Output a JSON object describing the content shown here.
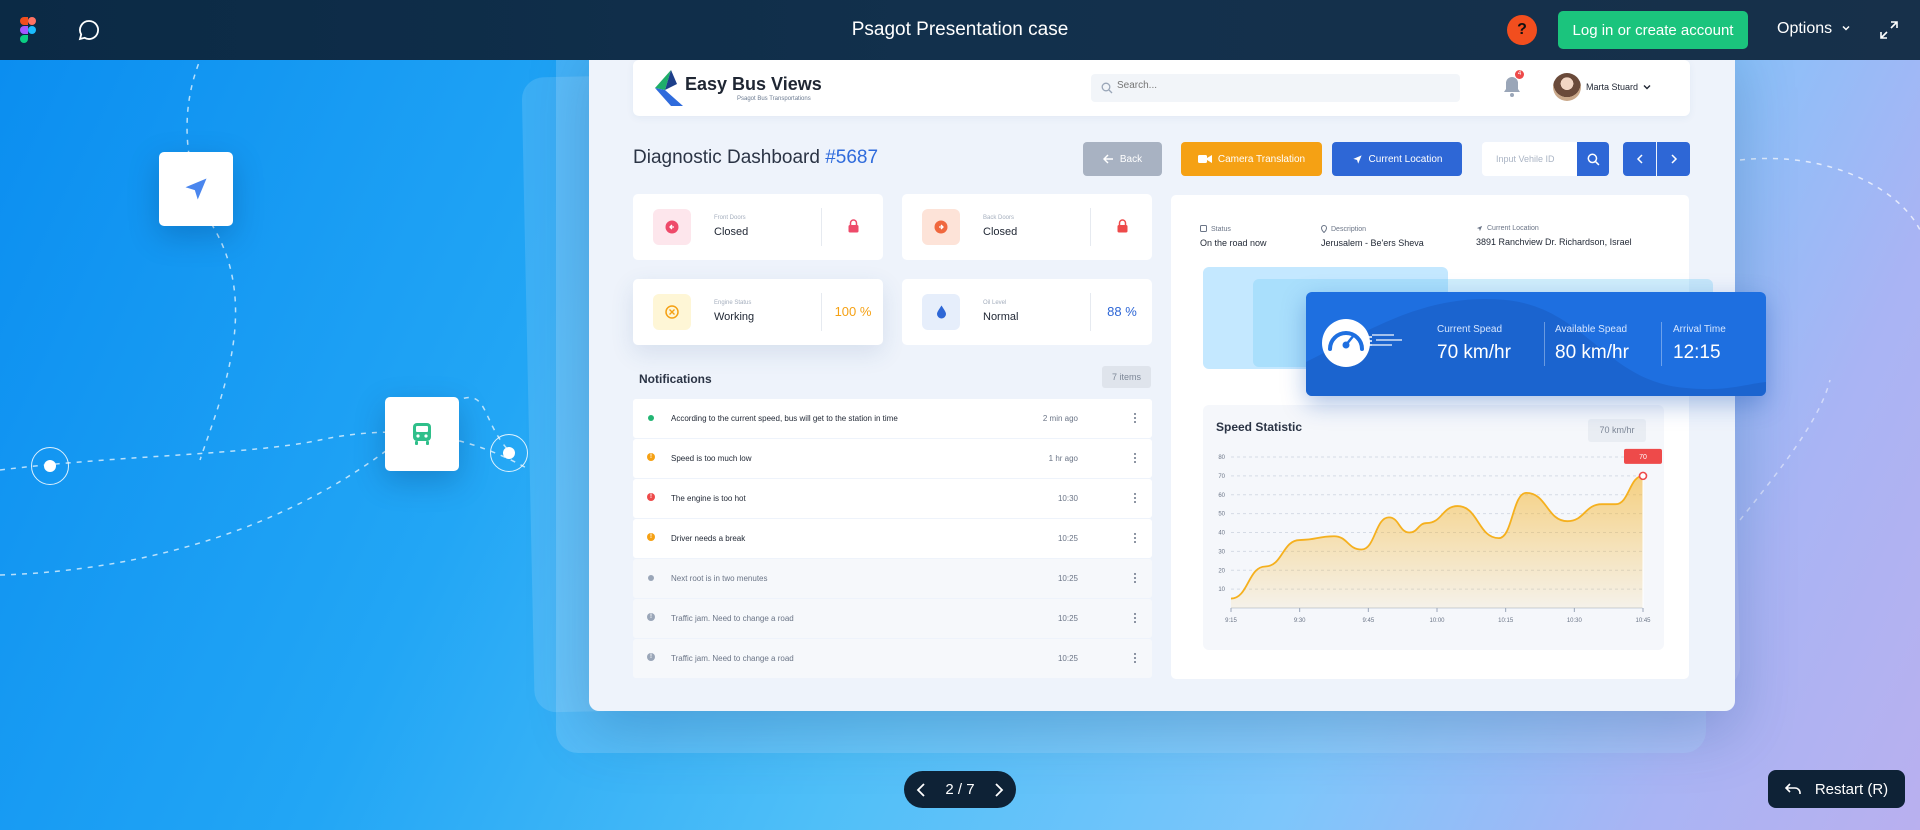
{
  "viewer": {
    "title": "Psagot Presentation case",
    "help_label": "?",
    "login_label": "Log in or create account",
    "options_label": "Options",
    "page_indicator": "2 / 7",
    "restart_label": "Restart (R)",
    "icons": [
      "figma-logo",
      "comment-icon",
      "chevron-down-icon",
      "expand-icon",
      "chevron-left-icon",
      "chevron-right-icon",
      "undo-icon",
      "navigation-arrow-icon",
      "bus-icon"
    ]
  },
  "app": {
    "logo_title": "Easy Bus Views",
    "logo_subtitle": "Psagot Bus Transportations",
    "search_placeholder": "Search...",
    "notification_badge": "4",
    "user_name": "Marta Stuard"
  },
  "page": {
    "title": "Diagnostic Dashboard",
    "vehicle_number": "#5687",
    "back_label": "Back",
    "camera_label": "Camera Translation",
    "location_label": "Current Location",
    "vehicle_input_placeholder": "Input Vehile ID"
  },
  "status_cards": [
    {
      "label": "Front Doors",
      "value": "Closed",
      "icon": "arrow-left-icon",
      "right_icon": "lock-icon",
      "color": "#ee4a6a"
    },
    {
      "label": "Back Doors",
      "value": "Closed",
      "icon": "arrow-right-icon",
      "right_icon": "lock-icon",
      "color": "#f0683e"
    },
    {
      "label": "Engine Status",
      "value": "Working",
      "icon": "engine-icon",
      "right_value": "100 %",
      "color": "#f5a114"
    },
    {
      "label": "Oil Level",
      "value": "Normal",
      "icon": "drop-icon",
      "right_value": "88 %",
      "color": "#2e67d6"
    }
  ],
  "notifications": {
    "title": "Notifications",
    "count_label": "7 items",
    "items": [
      {
        "text": "According to the current speed, bus will get to the station in time",
        "time": "2 min ago",
        "status": "ok",
        "color": "#22b573"
      },
      {
        "text": "Speed is too much low",
        "time": "1 hr ago",
        "status": "warning",
        "color": "#f5a114"
      },
      {
        "text": "The engine is too hot",
        "time": "10:30",
        "status": "error",
        "color": "#ee4a4a"
      },
      {
        "text": "Driver needs a break",
        "time": "10:25",
        "status": "warning",
        "color": "#f5a114"
      },
      {
        "text": "Next root is in two menutes",
        "time": "10:25",
        "status": "info",
        "color": "#9aa6b8"
      },
      {
        "text": "Traffic jam. Need to change a road",
        "time": "10:25",
        "status": "info",
        "color": "#9aa6b8"
      },
      {
        "text": "Traffic jam. Need to change a road",
        "time": "10:25",
        "status": "info",
        "color": "#9aa6b8"
      }
    ]
  },
  "trip_info": [
    {
      "label": "Status",
      "value": "On the road now",
      "icon": "bus-icon"
    },
    {
      "label": "Description",
      "value": "Jerusalem - Be'ers Sheva",
      "icon": "pin-icon"
    },
    {
      "label": "Current Location",
      "value": "3891 Ranchview Dr. Richardson, Israel",
      "icon": "navigation-icon"
    }
  ],
  "speed": {
    "current_label": "Current Spead",
    "current_value": "70 km/hr",
    "available_label": "Available Spead",
    "available_value": "80 km/hr",
    "arrival_label": "Arrival Time",
    "arrival_value": "12:15"
  },
  "speed_statistic": {
    "title": "Speed Statistic",
    "badge": "70 km/hr"
  },
  "chart_data": {
    "type": "area",
    "title": "Speed Statistic",
    "x_ticks": [
      "9:15",
      "9:30",
      "9:45",
      "10:00",
      "10:15",
      "10:30",
      "10:45"
    ],
    "y_ticks": [
      10,
      20,
      30,
      40,
      50,
      60,
      70,
      80
    ],
    "ylim": [
      0,
      80
    ],
    "xlim": [
      0,
      6
    ],
    "x": [
      0,
      0.5,
      1,
      1.5,
      1.9,
      2.3,
      2.6,
      2.85,
      3.3,
      3.9,
      4.3,
      4.9,
      5.4,
      5.6,
      6
    ],
    "values": [
      5,
      22,
      36,
      38,
      31,
      48,
      40,
      45,
      54,
      37,
      61,
      46,
      55,
      55,
      70
    ],
    "highlight": {
      "x": 6,
      "value": 70,
      "label": "70"
    },
    "grid": true,
    "color": "#f5b01e"
  }
}
